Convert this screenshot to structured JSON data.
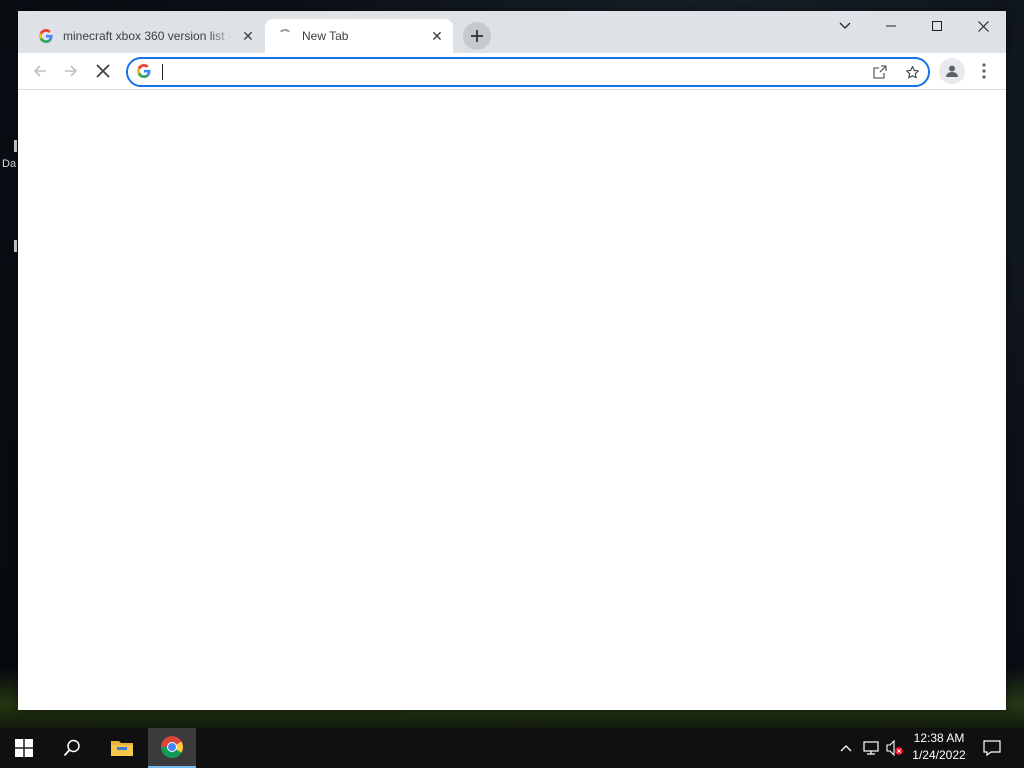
{
  "desktop": {
    "icon_label_partial": "Da"
  },
  "browser": {
    "tabs": [
      {
        "title": "minecraft xbox 360 version list - ",
        "favicon": "google-g-icon",
        "active": false
      },
      {
        "title": "New Tab",
        "favicon": "loading-spinner-icon",
        "active": true
      }
    ],
    "new_tab_icon": "plus-icon",
    "window_controls": [
      "tab-search-icon",
      "minimize-icon",
      "maximize-icon",
      "close-icon"
    ],
    "toolbar": {
      "back_icon": "arrow-left-icon",
      "forward_icon": "arrow-right-icon",
      "stop_icon": "stop-x-icon",
      "omnibox": {
        "value": "",
        "search_engine_icon": "google-g-icon"
      },
      "share_icon": "share-icon",
      "bookmark_icon": "star-icon",
      "profile_icon": "person-icon",
      "menu_icon": "kebab-menu-icon"
    },
    "accent_color": "#1a73e8"
  },
  "taskbar": {
    "apps": [
      "windows-start-icon",
      "search-icon",
      "file-explorer-icon",
      "chrome-icon"
    ],
    "tray": [
      "chevron-up-icon",
      "network-icon",
      "volume-muted-icon"
    ],
    "clock": {
      "time": "12:38 AM",
      "date": "1/24/2022"
    },
    "notification_icon": "notification-icon"
  }
}
